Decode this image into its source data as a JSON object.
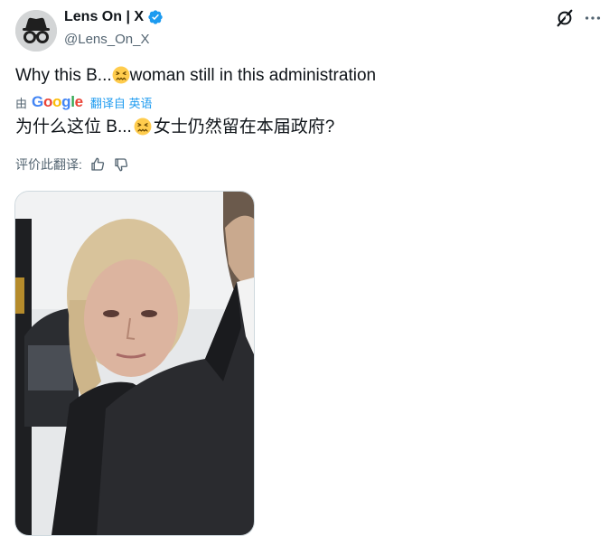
{
  "post": {
    "author": {
      "display_name": "Lens On | X",
      "handle": "@Lens_On_X",
      "avatar_icon": "incognito-icon",
      "verified": true
    },
    "text_before": "Why this B...",
    "text_after": "woman still in this administration",
    "translation": {
      "by_label": "由",
      "provider": "Google",
      "from_label": "翻译自 英语",
      "text_before": "为什么这位 B...",
      "text_after": "女士仍然留在本届政府?",
      "rate_label": "评价此翻译:"
    },
    "media": {
      "description_icon": "photo"
    }
  },
  "icons": {
    "grok": "grok-icon",
    "more": "more-icon",
    "emoji": "confounded-face-emoji",
    "thumbs_up": "thumbs-up-icon",
    "thumbs_down": "thumbs-down-icon"
  },
  "colors": {
    "accent": "#1d9bf0",
    "text": "#0f1419",
    "secondary": "#536471",
    "verified": "#1d9bf0"
  }
}
